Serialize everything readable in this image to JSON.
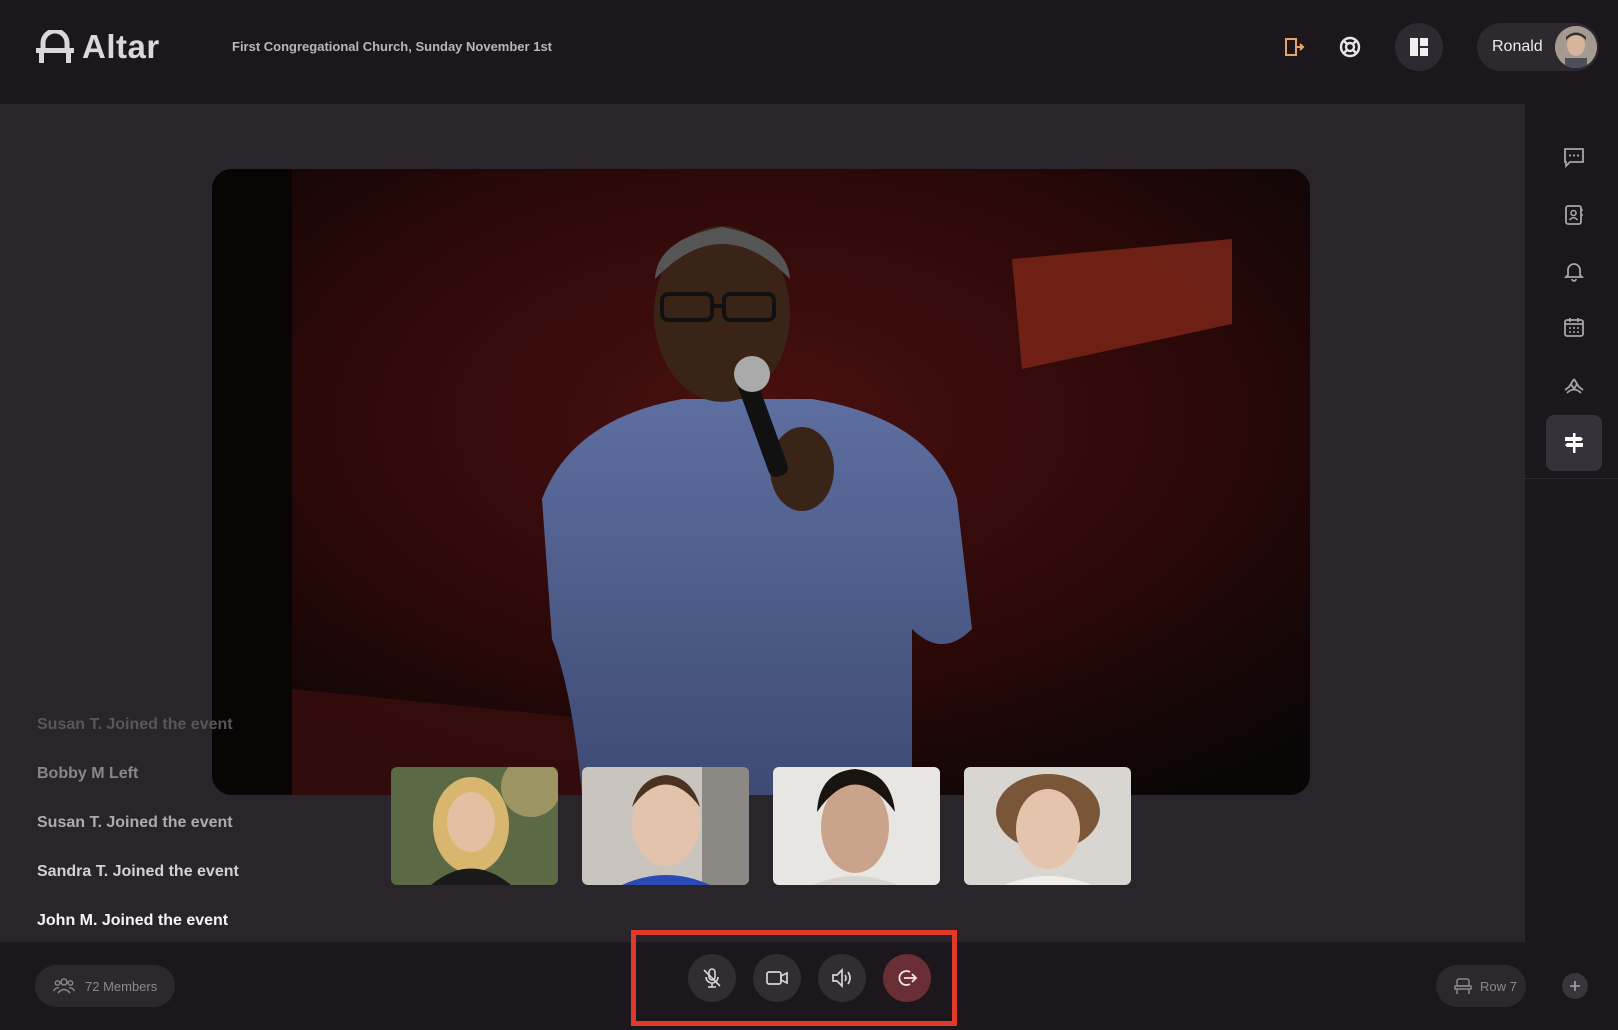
{
  "app": {
    "name": "Altar"
  },
  "header": {
    "event_title": "First Congregational Church, Sunday November 1st",
    "user_name": "Ronald"
  },
  "activity_feed": [
    {
      "text": "Susan T. Joined the event",
      "color": "#5a565c"
    },
    {
      "text": "Bobby M Left",
      "color": "#8a868c"
    },
    {
      "text": "Susan T. Joined the event",
      "color": "#aeaab0"
    },
    {
      "text": "Sandra T. Joined the event",
      "color": "#d4d0d6"
    },
    {
      "text": "John M. Joined the event",
      "color": "#f5f5f5"
    }
  ],
  "participants": [
    {
      "icon": "participant-woman-blonde"
    },
    {
      "icon": "participant-man-young"
    },
    {
      "icon": "participant-man-dark-hair"
    },
    {
      "icon": "participant-man-curly-hair"
    }
  ],
  "footer": {
    "members_label": "72 Members",
    "row_label": "Row 7"
  },
  "colors": {
    "accent_orange": "#e9a464",
    "highlight_red": "#e0392b",
    "leave_button": "#6a2e35"
  }
}
